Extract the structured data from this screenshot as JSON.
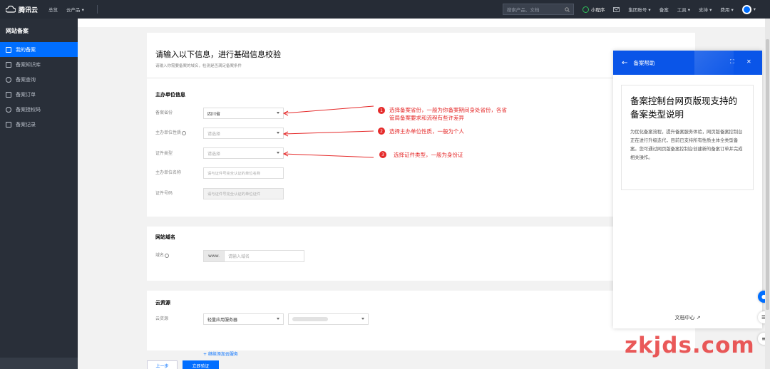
{
  "topbar": {
    "logo": "腾讯云",
    "nav": [
      "总览",
      "云产品 ▾"
    ],
    "search_placeholder": "搜索产品、文档",
    "mini_program": "小程序",
    "items": [
      "集团账号 ▾",
      "备案",
      "工具 ▾",
      "支持 ▾",
      "费用 ▾"
    ],
    "avatar_menu": "▾"
  },
  "sidebar": {
    "title": "网站备案",
    "items": [
      {
        "label": "我的备案"
      },
      {
        "label": "备案知识库"
      },
      {
        "label": "备案查询"
      },
      {
        "label": "备案订单"
      },
      {
        "label": "备案授权码"
      },
      {
        "label": "备案记录"
      }
    ]
  },
  "form": {
    "title": "请输入以下信息，进行基础信息校验",
    "subtitle": "请输入你需要备案的域名，检测是否满足备案条件",
    "section1": "主办单位信息",
    "fields": [
      {
        "label": "备案省份",
        "value": "四川省"
      },
      {
        "label": "主办单位性质",
        "value": "请选择"
      },
      {
        "label": "证件类型",
        "value": "请选择"
      },
      {
        "label": "主办单位名称",
        "value": "请与证件号完全认证的单位名称"
      },
      {
        "label": "证件号码",
        "value": "请与证件号完全认证的单位证件"
      }
    ],
    "section2": "网站域名",
    "domain_label": "域名",
    "domain_prefix": "www.",
    "domain_placeholder": "请输入域名",
    "section3": "云资源",
    "resource_label": "云资源",
    "resource_type": "轻量应用服务器",
    "add_link": "+ 继续添加云服务",
    "btn_prev": "上一步",
    "btn_next": "立即验证"
  },
  "annotations": [
    {
      "num": "1",
      "line1": "选择备案省份，一般为你备案期间身处省份，各省",
      "line2": "管局备案要求和流程有些许差异"
    },
    {
      "num": "2",
      "line1": "选择主办单位性质，一般为个人"
    },
    {
      "num": "3",
      "line1": "选择证件类型，一般为身份证"
    }
  ],
  "help": {
    "header": "备案帮助",
    "title": "备案控制台网页版现支持的备案类型说明",
    "body": "为优化备案流程，提升备案服务体验，网页版备案控制台正在进行升级迭代，目前已支持所有性质主体全类型备案。您可通过网页版备案控制台创建新的备案订单并完成相关操作。",
    "footer": "文档中心 ↗"
  },
  "watermark": "zkjds.com",
  "colors": {
    "accent": "#006eff",
    "annotation": "#e52a2a",
    "topbar": "#262c36"
  }
}
